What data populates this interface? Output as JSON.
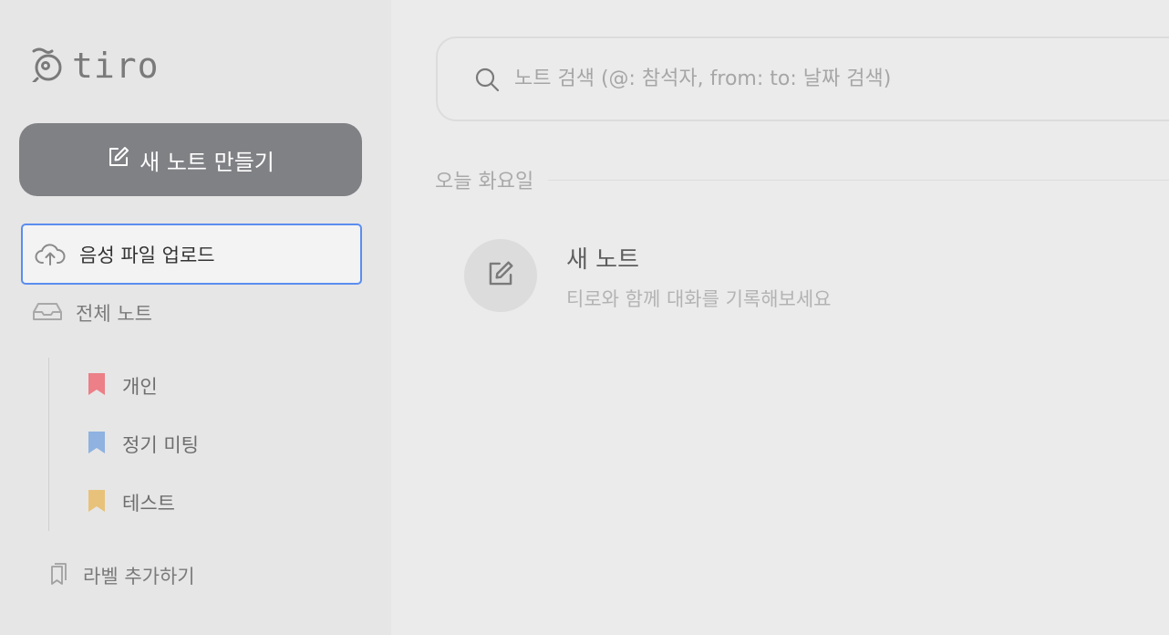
{
  "app": {
    "logo_text": "tiro"
  },
  "sidebar": {
    "new_note_label": "새 노트 만들기",
    "upload_label": "음성 파일 업로드",
    "all_notes_label": "전체 노트",
    "labels": [
      {
        "name": "개인",
        "color": "#ec7f87"
      },
      {
        "name": "정기 미팅",
        "color": "#8fb2e0"
      },
      {
        "name": "테스트",
        "color": "#e8c27a"
      }
    ],
    "add_label": "라벨 추가하기"
  },
  "search": {
    "placeholder": "노트 검색 (@: 참석자, from: to: 날짜 검색)",
    "value": ""
  },
  "main": {
    "section_title": "오늘 화요일",
    "note": {
      "title": "새 노트",
      "subtitle": "티로와 함께 대화를 기록해보세요"
    }
  },
  "colors": {
    "accent_border": "#5b8def",
    "primary_button": "#808185"
  }
}
